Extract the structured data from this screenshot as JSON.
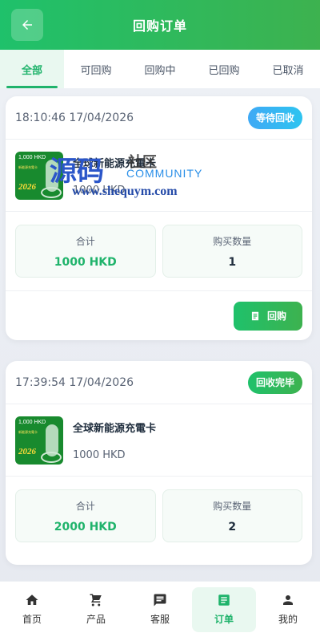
{
  "header": {
    "title": "回购订单"
  },
  "tabs": [
    {
      "label": "全部",
      "active": true
    },
    {
      "label": "可回购",
      "active": false
    },
    {
      "label": "回购中",
      "active": false
    },
    {
      "label": "已回购",
      "active": false
    },
    {
      "label": "已取消",
      "active": false
    }
  ],
  "orders": [
    {
      "time": "18:10:46 17/04/2026",
      "status": "等待回收",
      "product_name": "全球新能源充電卡",
      "price": "1000 HKD",
      "total_label": "合计",
      "total_value": "1000 HKD",
      "qty_label": "购买数量",
      "qty_value": "1",
      "action_label": "回购"
    },
    {
      "time": "17:39:54 17/04/2026",
      "status": "回收完毕",
      "product_name": "全球新能源充電卡",
      "price": "1000 HKD",
      "total_label": "合计",
      "total_value": "2000 HKD",
      "qty_label": "购买数量",
      "qty_value": "2"
    }
  ],
  "thumb": {
    "value": "1,000 HKD",
    "subtitle": "新能源充電卡",
    "year": "2026"
  },
  "watermark": {
    "big": "源码",
    "side": "社区",
    "community": "COMMUNITY",
    "url": "www.shequym.com"
  },
  "nav": [
    {
      "label": "首页",
      "icon": "home-icon",
      "active": false
    },
    {
      "label": "产品",
      "icon": "cart-icon",
      "active": false
    },
    {
      "label": "客服",
      "icon": "chat-icon",
      "active": false
    },
    {
      "label": "订单",
      "icon": "order-icon",
      "active": true
    },
    {
      "label": "我的",
      "icon": "person-icon",
      "active": false
    }
  ],
  "colors": {
    "accent": "#1fb36b",
    "waiting": "#3fa9f5"
  }
}
